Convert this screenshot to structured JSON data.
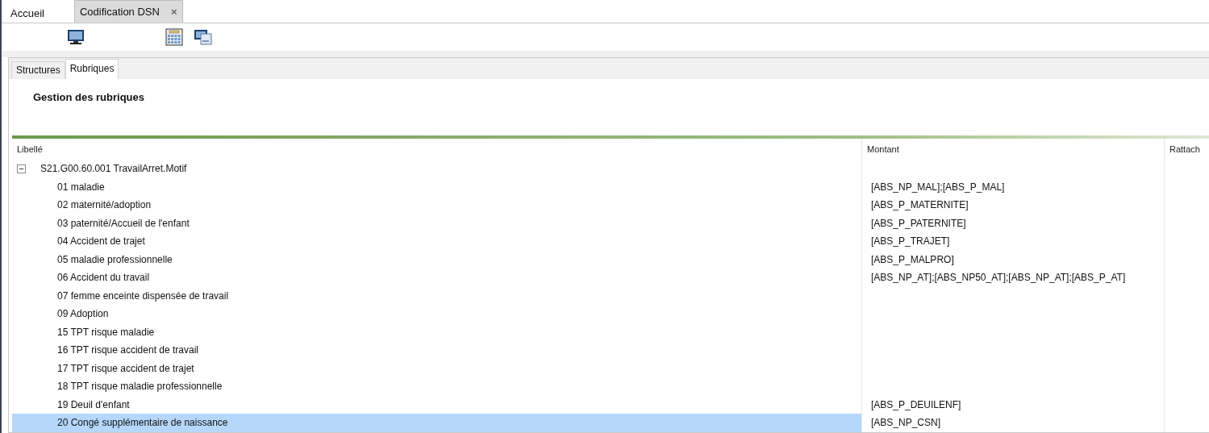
{
  "document_tabs": [
    {
      "label": "Accueil",
      "selected": false,
      "closable": false
    },
    {
      "label": "Codification DSN",
      "selected": true,
      "closable": true,
      "close": "×"
    }
  ],
  "view_tabs": [
    {
      "label": "Structures",
      "selected": false
    },
    {
      "label": "Rubriques",
      "selected": true
    }
  ],
  "heading": "Gestion des rubriques",
  "table": {
    "columns": [
      "Libellé",
      "Montant",
      "Rattach"
    ],
    "rows": [
      {
        "label": "S21.G00.60.001 TravailArret.Motif",
        "expanded": true,
        "selected": false,
        "children": [
          {
            "label": "01 maladie",
            "montant": "[ABS_NP_MAL];[ABS_P_MAL]",
            "selected": false
          },
          {
            "label": "02 maternité/adoption",
            "montant": "[ABS_P_MATERNITE]",
            "selected": false
          },
          {
            "label": "03 paternité/Accueil de l'enfant",
            "montant": "[ABS_P_PATERNITE]",
            "selected": false
          },
          {
            "label": "04 Accident de trajet",
            "montant": "[ABS_P_TRAJET]",
            "selected": false
          },
          {
            "label": "05 maladie professionnelle",
            "montant": "[ABS_P_MALPRO]",
            "selected": false
          },
          {
            "label": "06 Accident du travail",
            "montant": "[ABS_NP_AT];[ABS_NP50_AT];[ABS_NP_AT];[ABS_P_AT]",
            "selected": false
          },
          {
            "label": "07 femme enceinte dispensée de travail",
            "selected": false
          },
          {
            "label": "09 Adoption",
            "selected": false
          },
          {
            "label": "15 TPT risque maladie",
            "selected": false
          },
          {
            "label": "16 TPT risque accident de travail",
            "selected": false
          },
          {
            "label": "17 TPT risque accident de trajet",
            "selected": false
          },
          {
            "label": "18 TPT risque maladie professionnelle",
            "selected": false
          },
          {
            "label": "19 Deuil d'enfant",
            "montant": "[ABS_P_DEUILENF]",
            "selected": false
          },
          {
            "label": "20 Congé supplémentaire de naissance",
            "montant": "[ABS_NP_CSN]",
            "selected": true
          }
        ]
      }
    ]
  }
}
